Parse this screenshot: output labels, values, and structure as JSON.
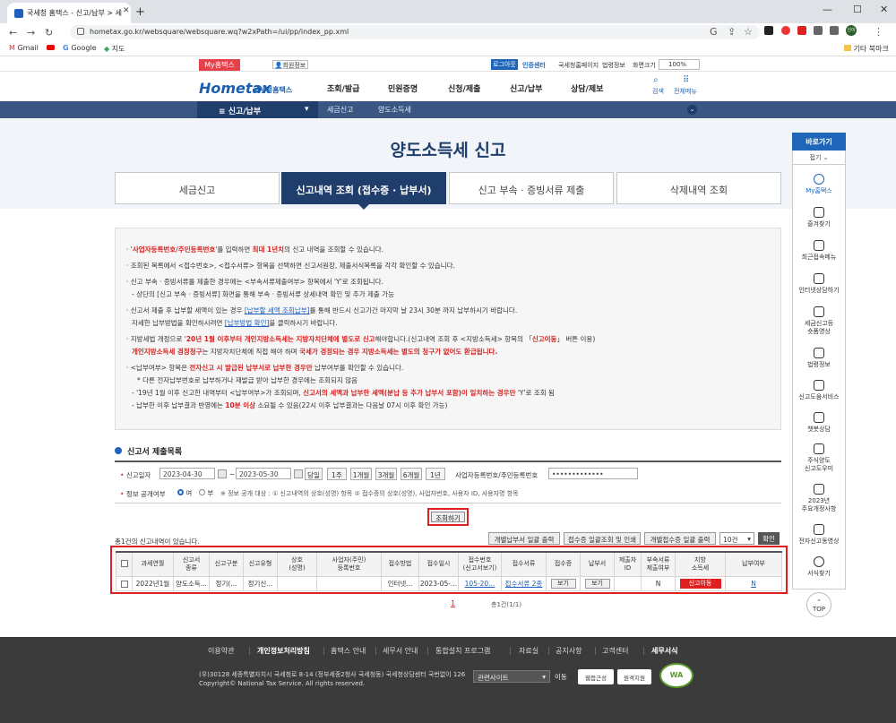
{
  "browser": {
    "tab_title": "국세청 홈택스 - 신고/납부 > 세",
    "url": "hometax.go.kr/websquare/websquare.wq?w2xPath=/ui/pp/index_pp.xml",
    "bookmarks": [
      "Gmail",
      "Google",
      "지도"
    ],
    "other_bookmarks": "기타 북마크",
    "profile_initials": "신이"
  },
  "site": {
    "myhome": "My홈택스",
    "member": "회원정보",
    "logout": "로그아웃",
    "cert": "인증센터",
    "util_links": [
      "국세청홈페이지",
      "법령정보",
      "화면크기"
    ],
    "zoom": "100%",
    "logo": "Hometax",
    "logo_sub": "국세청홈택스",
    "gnb": [
      "조회/발급",
      "민원증명",
      "신청/제출",
      "신고/납부",
      "상담/제보"
    ],
    "search_label": "검색",
    "menu_label": "전체메뉴",
    "location": [
      "신고/납부",
      "세금신고",
      "양도소득세"
    ]
  },
  "page": {
    "title": "양도소득세 신고",
    "tabs": [
      "세금신고",
      "신고내역 조회 (접수증 · 납부서)",
      "신고 부속 · 증빙서류 제출",
      "삭제내역 조회"
    ],
    "notices": {
      "n1a": "· '",
      "n1b": "사업자등록번호/주민등록번호",
      "n1c": "'를 입력하면 ",
      "n1d": "최대 1년치",
      "n1e": "의 신고 내역을 조회할 수 있습니다.",
      "n2": "· 조회된 목록에서 <접수번호>, <접수서류> 항목을 선택하면 신고서원장, 제출서식목록을 각각 확인할 수 있습니다.",
      "n3": "· 신고 부속 · 증빙서류를 제출한 경우에는 <부속서류제출여부> 항목에서 'Y'로 조회됩니다.",
      "n3b": "- 상단의 [신고 부속 · 증빙서류] 화면을 통해 부속 · 증빙서류 상세내역 확인 및 추가 제출 가능",
      "n4a": "· 신고서 제출 후 납부할 세액이 있는 경우 ",
      "n4b": "[납부할 세액 조회납부]",
      "n4c": "를 통해 반드시 신고기간 마지막 날 23시 30분 까지 납부하시기 바랍니다.",
      "n4d": "자세한 납부방법을 확인하시려면 ",
      "n4e": "[납부방법 확인]",
      "n4f": "을 클릭하시기 바랍니다.",
      "n5a": "· 지방세법 개정으로 '",
      "n5b": "20년 1월 이후부터 개인지방소득세는 지방자치단체에 별도로 신고",
      "n5c": "해야합니다.(신고내역 조회 후 <지방소득세> 항목의 「",
      "n5d": "신고이동",
      "n5e": "」 버튼 이용)",
      "n5f": "개인지방소득세 경정청구",
      "n5g": "는 지방자치단체에 직접 해야 하며 ",
      "n5h": "국세가 경정되는 경우 지방소득세는 별도의 청구가 없어도 환급됩니다.",
      "n6a": "· <납부여부> 항목은 ",
      "n6b": "전자신고 시 발급된 납부서로 납부한 경우만",
      "n6c": " 납부여부를 확인할 수 있습니다.",
      "n7": "* 다른 전자납부번호로 납부하거나 재발급 받아 납부한 경우에는 조회되지 않음",
      "n8a": "- '19년 1월 이후 신고한 내역부터 <납부여부>가 조회되며, ",
      "n8b": "신고서의 세액과 납부한 세액(분납 등 추가 납부서 포함)이 일치하는 경우만",
      "n8c": " 'Y'로 조회 됨",
      "n9a": "- 납부한 이후 납부결과 반영에는 ",
      "n9b": "10분 이상",
      "n9c": " 소요될 수 있음(22시 이후 납부결과는 다음날 07시 이후 확인 가능)"
    }
  },
  "search": {
    "section_title": "신고서 제출목록",
    "date_label": "신고일자",
    "date_from": "2023-04-30",
    "date_sep": "~",
    "date_to": "2023-05-30",
    "periods": [
      "당일",
      "1주",
      "1개월",
      "3개월",
      "6개월",
      "1년"
    ],
    "id_label": "사업자등록번호/주민등록번호",
    "id_value": "•••••••••••••",
    "public_label": "정보 공개여부",
    "yes": "여",
    "no": "부",
    "public_note": "※ 정보 공개 대상 : ① 신고내역의 상호(성명) 항목 ② 접수증의 상호(성명), 사업자번호, 사용자 ID, 사용자명 항목",
    "search_button": "조회하기"
  },
  "results": {
    "count_text": "총1건의 신고내역이 있습니다.",
    "actions": [
      "개별납부서 일괄 출력",
      "접수증 일괄조회 및 인쇄",
      "개별접수증 일괄 출력"
    ],
    "page_size": "10건",
    "ok": "확인",
    "headers": [
      "과세연월",
      "신고서\n종류",
      "신고구분",
      "신고유형",
      "상호\n(성명)",
      "사업자(주민)\n등록번호",
      "접수방법",
      "접수일시",
      "접수번호\n(신고서보기)",
      "접수서류",
      "접수증",
      "납부서",
      "제출자\nID",
      "부속서류\n제출여부",
      "지방\n소득세",
      "납부여부"
    ],
    "row": {
      "period": "2022년1월",
      "kind": "양도소득...",
      "div": "정기(...",
      "type": "정기신...",
      "name": "",
      "regno": "",
      "method": "인터넷...",
      "date": "2023-05-...",
      "receipt_no": "105-20...",
      "docs": "접수서류 2종",
      "receipt_btn": "보기",
      "bill_btn": "보기",
      "submitter": "",
      "attach": "N",
      "local_tax_btn": "신고이동",
      "paid": "N"
    },
    "page": "1",
    "page_count": "총1건(1/1)"
  },
  "quick": {
    "title": "바로가기",
    "fold": "접기",
    "items": [
      "My홈택스",
      "즐겨찾기",
      "최근접속메뉴",
      "인터넷상담하기",
      "세금신고등\n숏폼영상",
      "법령정보",
      "신고도움서비스",
      "챗봇상담",
      "주식양도\n신고도우미",
      "2023년\n주요개정사항",
      "전자신고동영상",
      "서식찾기"
    ],
    "top": "TOP"
  },
  "footer": {
    "links": [
      "이용약관",
      "개인정보처리방침",
      "홈택스 안내",
      "세무서 안내",
      "통합설치 프로그램",
      "자료실",
      "공지사항",
      "고객센터",
      "세무서식"
    ],
    "address": "(우)30128 세종특별자치시 국세청로 8-14 (정부세종2청사 국세청동) 국세청상담센터 국번없이 126",
    "copyright": "Copyright© National Tax Service. All rights reserved.",
    "related": "관련사이트",
    "go": "이동",
    "logos": [
      "웹접근성",
      "원격지원"
    ],
    "wa": "WA"
  }
}
